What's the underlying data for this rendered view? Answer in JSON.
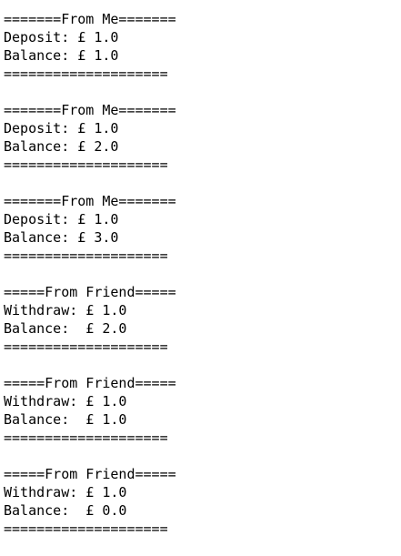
{
  "console": {
    "lines": [
      "=======From Me=======",
      "Deposit: £ 1.0",
      "Balance: £ 1.0",
      "====================",
      "",
      "=======From Me=======",
      "Deposit: £ 1.0",
      "Balance: £ 2.0",
      "====================",
      "",
      "=======From Me=======",
      "Deposit: £ 1.0",
      "Balance: £ 3.0",
      "====================",
      "",
      "=====From Friend=====",
      "Withdraw: £ 1.0",
      "Balance:  £ 2.0",
      "====================",
      "",
      "=====From Friend=====",
      "Withdraw: £ 1.0",
      "Balance:  £ 1.0",
      "====================",
      "",
      "=====From Friend=====",
      "Withdraw: £ 1.0",
      "Balance:  £ 0.0",
      "===================="
    ]
  }
}
